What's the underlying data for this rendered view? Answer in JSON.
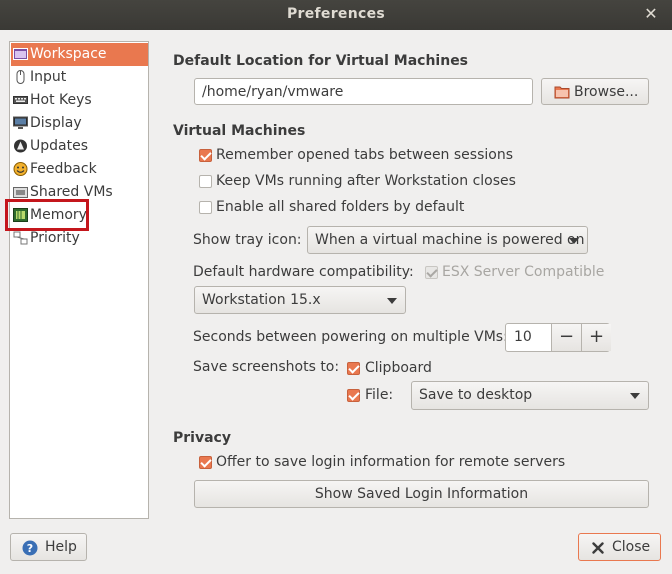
{
  "window": {
    "title": "Preferences",
    "close_glyph": "✕"
  },
  "sidebar": {
    "items": [
      {
        "label": "Workspace",
        "icon": "workspace-icon",
        "active": true
      },
      {
        "label": "Input",
        "icon": "mouse-icon"
      },
      {
        "label": "Hot Keys",
        "icon": "keyboard-icon"
      },
      {
        "label": "Display",
        "icon": "monitor-icon"
      },
      {
        "label": "Updates",
        "icon": "updates-icon"
      },
      {
        "label": "Feedback",
        "icon": "feedback-icon"
      },
      {
        "label": "Shared VMs",
        "icon": "shared-vms-icon"
      },
      {
        "label": "Memory",
        "icon": "memory-chip-icon"
      },
      {
        "label": "Priority",
        "icon": "priority-icon"
      }
    ]
  },
  "default_location": {
    "heading": "Default Location for Virtual Machines",
    "path": "/home/ryan/vmware",
    "browse_label": "Browse..."
  },
  "virtual_machines": {
    "heading": "Virtual Machines",
    "remember_tabs": {
      "label": "Remember opened tabs between sessions",
      "checked": true
    },
    "keep_running": {
      "label": "Keep VMs running after Workstation closes",
      "checked": false
    },
    "shared_folders": {
      "label": "Enable all shared folders by default",
      "checked": false
    },
    "tray_icon_label": "Show tray icon:",
    "tray_icon_value": "When a virtual machine is powered on",
    "hw_compat_label": "Default hardware compatibility:",
    "esx_label": "ESX Server Compatible",
    "hw_compat_value": "Workstation 15.x",
    "seconds_label": "Seconds between powering on multiple VMs:",
    "seconds_value": "10",
    "minus": "−",
    "plus": "+",
    "screenshots_label": "Save screenshots to:",
    "clipboard": {
      "label": "Clipboard",
      "checked": true
    },
    "file": {
      "label": "File:",
      "checked": true
    },
    "file_value": "Save to desktop"
  },
  "privacy": {
    "heading": "Privacy",
    "offer_save": {
      "label": "Offer to save login information for remote servers",
      "checked": true
    },
    "show_saved_label": "Show Saved Login Information"
  },
  "footer": {
    "help_label": "Help",
    "close_label": "Close"
  },
  "colors": {
    "accent": "#e9784f",
    "highlight_box": "#c4161c",
    "titlebar": "#3c3b37"
  }
}
